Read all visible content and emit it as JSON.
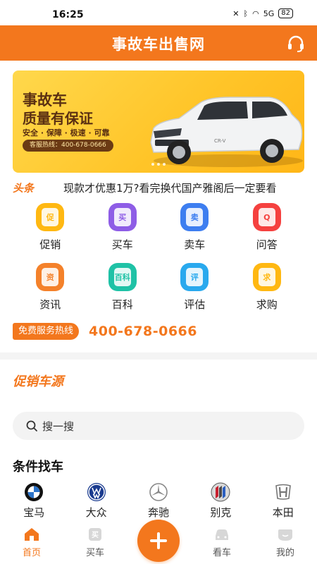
{
  "status_bar": {
    "time": "16:25",
    "network": "5G",
    "battery": "82"
  },
  "header": {
    "title": "事故车出售网",
    "support_icon": "headset-icon"
  },
  "banner": {
    "title_line1": "事故车",
    "title_line2": "质量有保证",
    "tags": "安全 · 保障 · 极速 · 可靠",
    "hotline": "客服热线：400-678-0666",
    "car_badge": "CR-V"
  },
  "news": {
    "tag": "头条",
    "text": "现款才优惠1万?看完换代国产雅阁后一定要看"
  },
  "menu": [
    {
      "label": "促销",
      "icon": "promotion-icon",
      "glyph": "促",
      "color": "#ffb812"
    },
    {
      "label": "买车",
      "icon": "buy-car-icon",
      "glyph": "买",
      "color": "#8e5de6"
    },
    {
      "label": "卖车",
      "icon": "sell-car-icon",
      "glyph": "卖",
      "color": "#3d7ef0"
    },
    {
      "label": "问答",
      "icon": "qa-icon",
      "glyph": "Q",
      "color": "#f5413f"
    },
    {
      "label": "资讯",
      "icon": "news-icon",
      "glyph": "资",
      "color": "#f4812a"
    },
    {
      "label": "百科",
      "icon": "encyclopedia-icon",
      "glyph": "百科",
      "color": "#1fc2a6"
    },
    {
      "label": "评估",
      "icon": "evaluate-icon",
      "glyph": "评",
      "color": "#29a9ee"
    },
    {
      "label": "求购",
      "icon": "request-buy-icon",
      "glyph": "求",
      "color": "#ffb812"
    }
  ],
  "hotline": {
    "badge": "免费服务热线",
    "number": "400-678-0666"
  },
  "promo_section": {
    "title": "促销车源"
  },
  "search": {
    "placeholder": "搜一搜"
  },
  "filter": {
    "title": "条件找车",
    "brands": [
      {
        "name": "宝马",
        "logo": "bmw-logo"
      },
      {
        "name": "大众",
        "logo": "volkswagen-logo"
      },
      {
        "name": "奔驰",
        "logo": "mercedes-logo"
      },
      {
        "name": "别克",
        "logo": "buick-logo"
      },
      {
        "name": "本田",
        "logo": "honda-logo"
      }
    ]
  },
  "tabbar": {
    "tabs": [
      {
        "label": "首页",
        "icon": "home-icon",
        "active": true
      },
      {
        "label": "买车",
        "icon": "buy-car-icon",
        "active": false
      },
      {
        "label": "",
        "icon": "plus-icon",
        "active": false
      },
      {
        "label": "看车",
        "icon": "view-car-icon",
        "active": false
      },
      {
        "label": "我的",
        "icon": "profile-icon",
        "active": false
      }
    ]
  },
  "colors": {
    "brand_orange": "#f3771d",
    "banner_yellow": "#ffc529"
  }
}
